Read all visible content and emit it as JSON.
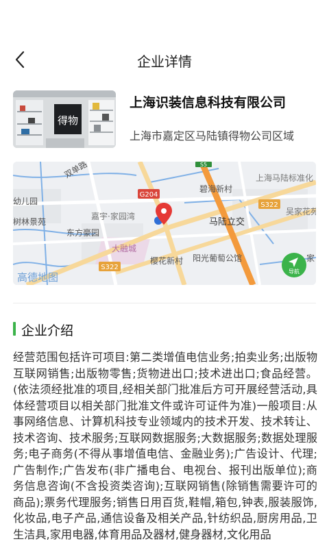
{
  "header": {
    "title": "企业详情"
  },
  "company": {
    "name": "上海识装信息科技有限公司",
    "address": "上海市嘉定区马陆镇得物公司区域",
    "thumbnail_sign": "得物"
  },
  "map": {
    "labels": {
      "shuangdan": "双单路",
      "youeryuan": "幼儿园",
      "shulinjingyuan": "树林景苑",
      "dongfangjiayuan": "东方豪园",
      "jiayulu": "嘉宇·家园湾",
      "darongcheng": "大融城",
      "yingchuan": "樱花新村",
      "yangguang": "阳光葡萄公馆",
      "bihai": "碧海新村",
      "malulijiao": "马陆立交",
      "shanghaimalu": "上海马陆标准化",
      "jiahuayuan": "吴家花苑",
      "jiaxiao": "家",
      "g204": "G204",
      "s322_top": "S322",
      "s322_bottom": "S322",
      "s5": "S5",
      "brand": "高德地图",
      "nav": "导航"
    },
    "colors": {
      "highway": "#f39a3c",
      "road": "#f7d89a",
      "water": "#7fb0e6",
      "marker": "#e53935",
      "nav_button": "#3bb34a"
    }
  },
  "intro": {
    "title": "企业介绍",
    "text": "经营范围包括许可项目:第二类增值电信业务;拍卖业务;出版物互联网销售;出版物零售;货物进出口;技术进出口;食品经营。(依法须经批准的项目,经相关部门批准后方可开展经营活动,具体经营项目以相关部门批准文件或许可证件为准)一般项目:从事网络信息、计算机科技专业领域内的技术开发、技术转让、技术咨询、技术服务;互联网数据服务;大数据服务;数据处理服务;电子商务(不得从事增值电信、金融业务);广告设计、代理;广告制作;广告发布(非广播电台、电视台、报刊出版单位);商务信息咨询(不含投资类咨询);互联网销售(除销售需要许可的商品);票务代理服务;销售日用百货,鞋帽,箱包,钟表,服装服饰,化妆品,电子产品,通信设备及相关产品,针纺织品,厨房用品,卫生洁具,家用电器,体育用品及器材,健身器材,文化用品"
  },
  "accent_color": "#3bb34a"
}
